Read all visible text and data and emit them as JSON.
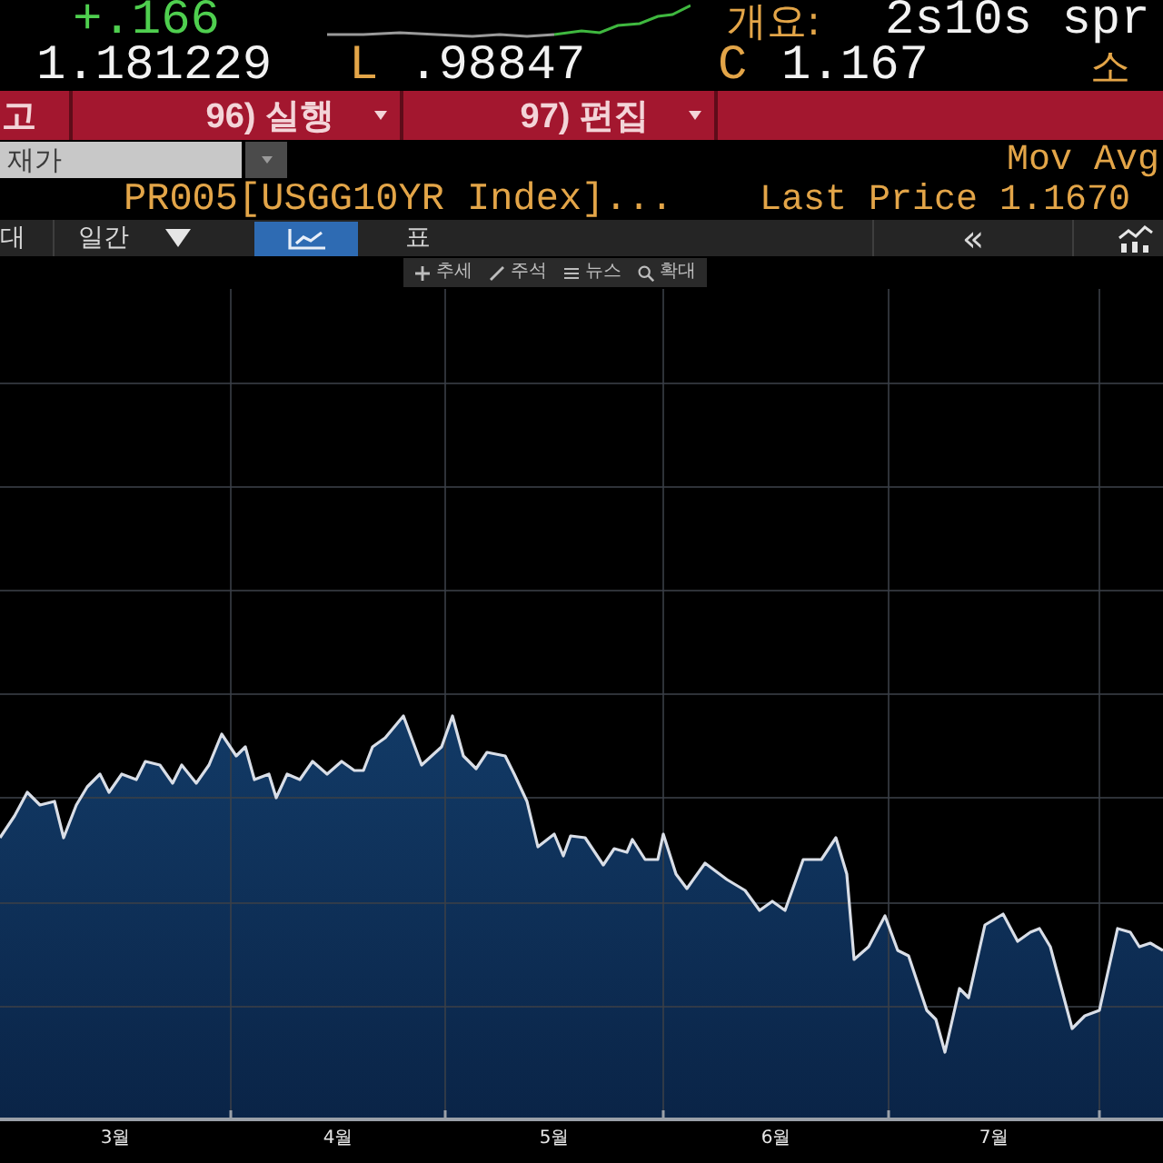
{
  "quote": {
    "change": "+.166",
    "summary_label": "개요:",
    "summary_value": "2s10s spr",
    "last": "1.181229",
    "low_label": "L",
    "low": ".98847",
    "close_label": "C",
    "close": "1.167",
    "owner_label": "소"
  },
  "action_bar": {
    "items": [
      {
        "label": "고",
        "dropdown": false
      },
      {
        "label": "96) 실행",
        "dropdown": true
      },
      {
        "label": "97) 편집",
        "dropdown": true
      }
    ]
  },
  "price_field": {
    "value": "재가"
  },
  "overlay": {
    "label": "Mov Avg"
  },
  "legend": {
    "series": "PR005[USGG10YR Index]...",
    "last_price": "Last Price 1.1670"
  },
  "toolbar": {
    "left_label": "대",
    "period": "일간",
    "views": [
      {
        "kind": "chart",
        "selected": true
      },
      {
        "kind": "table",
        "label": "표",
        "selected": false
      }
    ],
    "collapse": "«"
  },
  "tools": [
    {
      "kind": "trend",
      "label": "추세"
    },
    {
      "kind": "annotation",
      "label": "주석"
    },
    {
      "kind": "news",
      "label": "뉴스"
    },
    {
      "kind": "zoom",
      "label": "확대"
    }
  ],
  "chart": {
    "x_labels": [
      "3월",
      "4월",
      "5월",
      "6월",
      "7월"
    ]
  }
}
